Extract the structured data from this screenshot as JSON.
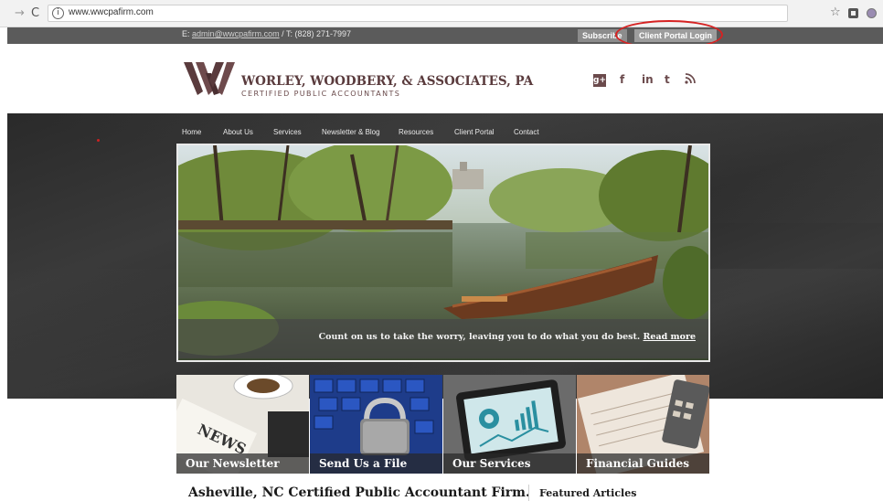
{
  "browser": {
    "url": "www.wwcpafirm.com",
    "forward_glyph": "→",
    "reload_glyph": "C",
    "info_glyph": "i",
    "star_glyph": "☆",
    "icons": [
      "arrow-right-icon",
      "reload-icon",
      "info-icon",
      "star-icon",
      "extension-icon",
      "profile-icon"
    ]
  },
  "topbar": {
    "email_prefix": "E: ",
    "email": "admin@wwcpafirm.com",
    "phone": " / T: (828) 271-7997",
    "subscribe_label": "Subscribe",
    "portal_login_label": "Client Portal Login",
    "highlight_color": "#d62222"
  },
  "header": {
    "firm_name": "WORLEY, WOODBERY, & ASSOCIATES, PA",
    "firm_subtitle": "CERTIFIED PUBLIC ACCOUNTANTS",
    "brand_color": "#5a3b3d",
    "social": [
      {
        "icon": "google-plus-icon",
        "glyph": "g+"
      },
      {
        "icon": "facebook-icon",
        "glyph": "f"
      },
      {
        "icon": "linkedin-icon",
        "glyph": "in"
      },
      {
        "icon": "tumblr-icon",
        "glyph": "t"
      },
      {
        "icon": "rss-icon",
        "glyph": "⋯"
      }
    ]
  },
  "nav": {
    "items": [
      "Home",
      "About Us",
      "Services",
      "Newsletter & Blog",
      "Resources",
      "Client Portal",
      "Contact"
    ]
  },
  "hero": {
    "caption": "Count on us to take the worry, leaving you to do what you do best. ",
    "read_more": "Read more"
  },
  "tiles": [
    {
      "label": "Our Newsletter",
      "icon": "newspaper-image"
    },
    {
      "label": "Send Us a File",
      "icon": "keyboard-lock-image"
    },
    {
      "label": "Our Services",
      "icon": "tablet-chart-image"
    },
    {
      "label": "Financial Guides",
      "icon": "tax-form-calculator-image"
    }
  ],
  "content": {
    "heading": "Asheville, NC Certified Public Accountant Firm.",
    "featured_heading": "Featured Articles"
  }
}
